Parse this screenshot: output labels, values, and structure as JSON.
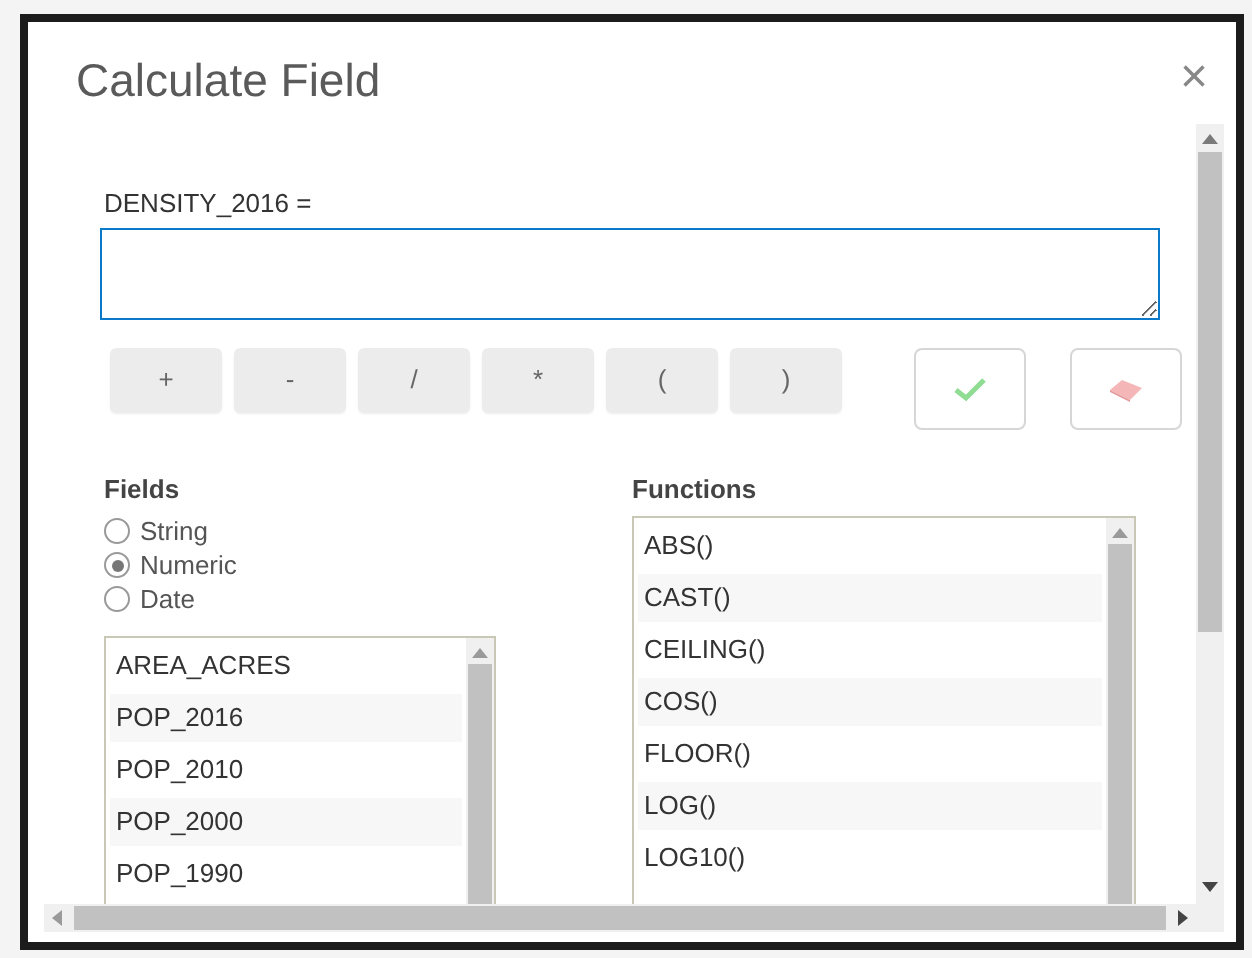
{
  "dialog": {
    "title": "Calculate Field",
    "close": "×"
  },
  "expression": {
    "label": "DENSITY_2016 ="
  },
  "operators": [
    "+",
    "-",
    "/",
    "*",
    "(",
    ")"
  ],
  "fields": {
    "heading": "Fields",
    "types": [
      {
        "label": "String",
        "selected": false
      },
      {
        "label": "Numeric",
        "selected": true
      },
      {
        "label": "Date",
        "selected": false
      }
    ],
    "items": [
      "AREA_ACRES",
      "POP_2016",
      "POP_2010",
      "POP_2000",
      "POP_1990"
    ]
  },
  "functions": {
    "heading": "Functions",
    "items": [
      "ABS()",
      "CAST()",
      "CEILING()",
      "COS()",
      "FLOOR()",
      "LOG()",
      "LOG10()"
    ]
  }
}
